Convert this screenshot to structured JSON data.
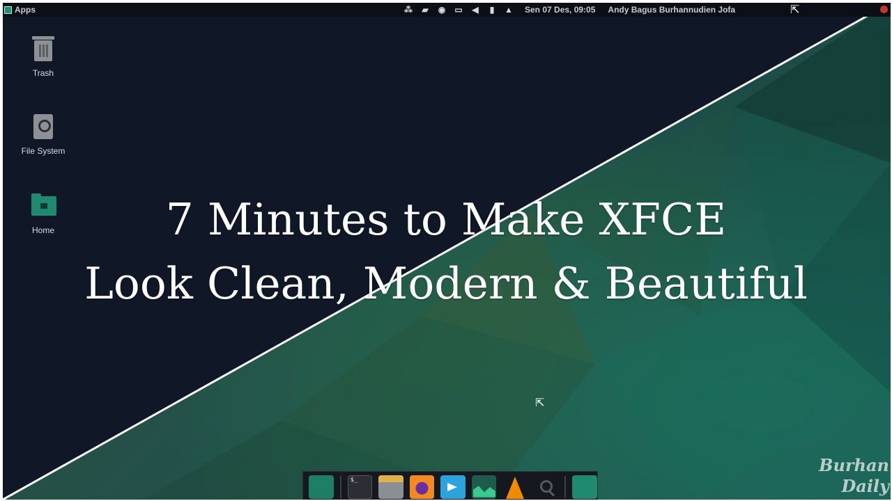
{
  "panel": {
    "apps_label": "Apps",
    "tray_icons": [
      "dropbox-icon",
      "camera-icon",
      "shield-icon",
      "display-icon",
      "volume-icon",
      "battery-icon",
      "bell-icon"
    ],
    "clock": "Sen 07 Des, 09:05",
    "user": "Andy Bagus Burhannudien Jofa"
  },
  "desktop": {
    "icons": [
      {
        "label": "Trash"
      },
      {
        "label": "File System"
      },
      {
        "label": "Home"
      }
    ]
  },
  "title": {
    "line1": "7 Minutes to Make XFCE",
    "line2": "Look Clean, Modern & Beautiful"
  },
  "dock": {
    "apps": [
      "files-icon",
      "terminal-icon",
      "archive-icon",
      "firefox-icon",
      "telegram-icon",
      "system-monitor-icon",
      "vlc-icon",
      "search-icon",
      "folder-icon"
    ]
  },
  "watermark": {
    "line1": "Burhan",
    "line2": "Daily"
  },
  "colors": {
    "left_bg": "#101727",
    "right_bg": "#23514a",
    "accent": "#1f8a6f"
  }
}
